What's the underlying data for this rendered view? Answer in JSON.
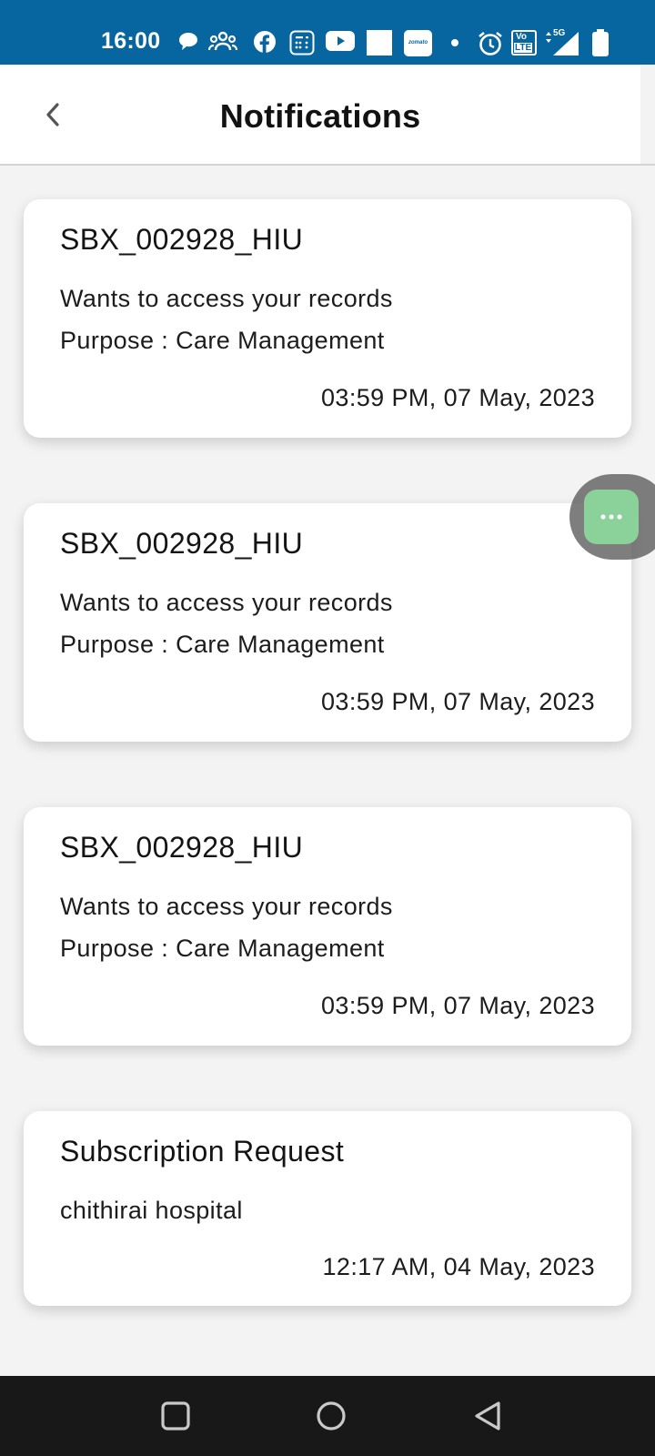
{
  "status_bar": {
    "time": "16:00",
    "icons": [
      "chat-bubble-icon",
      "group-icon",
      "facebook-icon",
      "calculator-icon",
      "youtube-icon",
      "white-square-icon",
      "zomato-icon",
      "dot-icon",
      "alarm-icon",
      "volte-icon",
      "signal-5g-icon",
      "battery-icon"
    ],
    "zomato_label": "zomato",
    "volte_label_top": "Vo",
    "volte_label_bottom": "LTE",
    "network_label": "5G",
    "background_color": "#07659f"
  },
  "header": {
    "title": "Notifications"
  },
  "notifications": [
    {
      "title": "SBX_002928_HIU",
      "line1": "Wants to access your records",
      "line2": "Purpose : Care Management",
      "timestamp": "03:59 PM, 07 May, 2023"
    },
    {
      "title": "SBX_002928_HIU",
      "line1": "Wants to access your records",
      "line2": "Purpose : Care Management",
      "timestamp": "03:59 PM, 07 May, 2023"
    },
    {
      "title": "SBX_002928_HIU",
      "line1": "Wants to access your records",
      "line2": "Purpose : Care Management",
      "timestamp": "03:59 PM, 07 May, 2023"
    },
    {
      "title": "Subscription Request",
      "line1": "chithirai hospital",
      "timestamp": "12:17 AM, 04 May, 2023"
    }
  ],
  "floating_button": {
    "icon": "more-dots-icon",
    "color": "#8bd19a"
  },
  "nav_bar": {
    "buttons": [
      "recents-square-icon",
      "home-circle-icon",
      "back-triangle-icon"
    ]
  }
}
